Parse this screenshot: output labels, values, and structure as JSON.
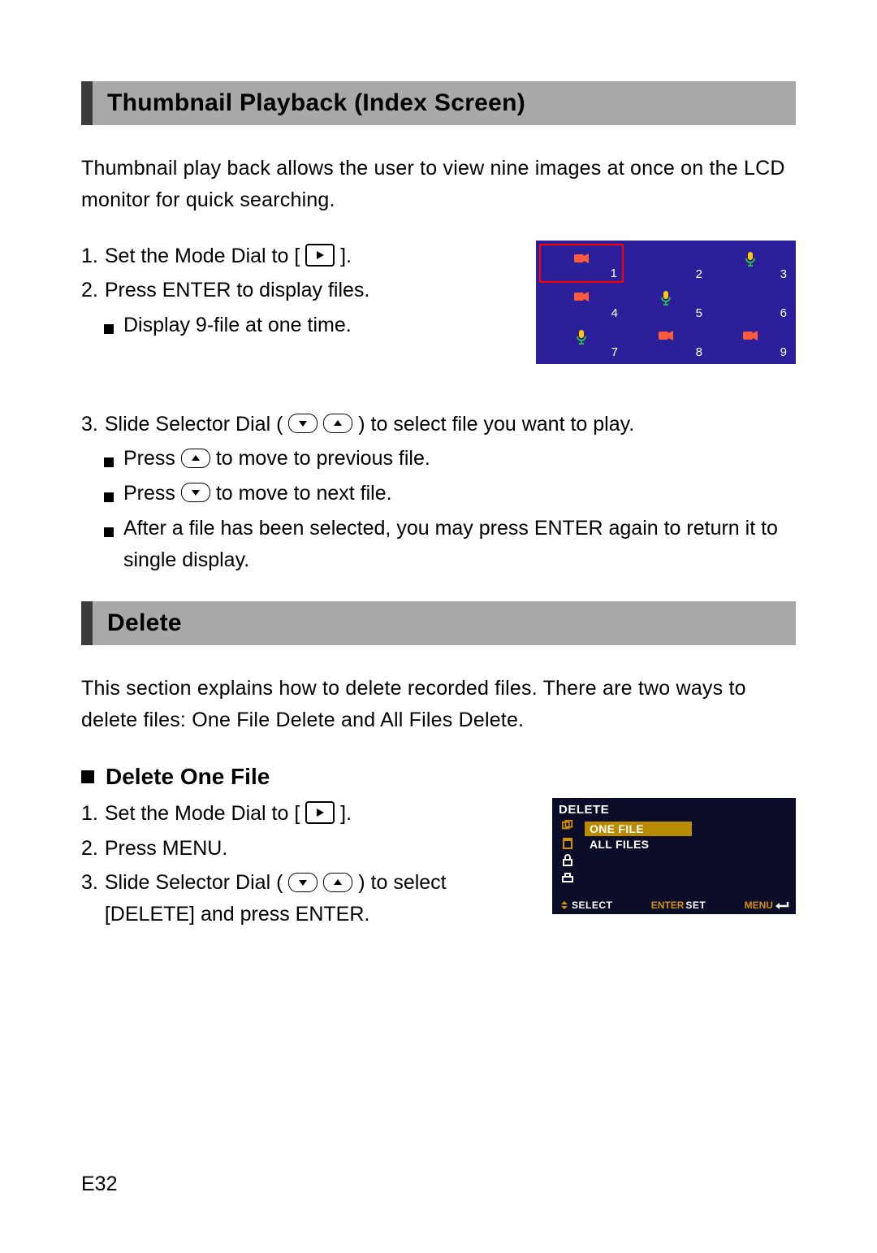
{
  "section1": {
    "title": "Thumbnail Playback (Index Screen)",
    "intro": "Thumbnail play back allows the user to view nine images at once on the LCD monitor for quick searching.",
    "step1_pre": "Set the Mode Dial to [",
    "step1_post": "].",
    "step2": "Press ENTER to display files.",
    "step2_sub": "Display 9-file at one time.",
    "step3_pre": "Slide Selector Dial (",
    "step3_post": ") to select file you want to play.",
    "step3_sub1_pre": "Press",
    "step3_sub1_post": "to move to previous file.",
    "step3_sub2_pre": "Press",
    "step3_sub2_post": "to move to next file.",
    "step3_sub3": "After a file has been selected, you may press ENTER again to return it to single display."
  },
  "thumbnails": {
    "cells": [
      {
        "n": "1",
        "icon": "video",
        "selected": true
      },
      {
        "n": "2",
        "icon": "",
        "selected": false
      },
      {
        "n": "3",
        "icon": "mic",
        "selected": false
      },
      {
        "n": "4",
        "icon": "video",
        "selected": false
      },
      {
        "n": "5",
        "icon": "mic",
        "selected": false
      },
      {
        "n": "6",
        "icon": "",
        "selected": false
      },
      {
        "n": "7",
        "icon": "mic",
        "selected": false
      },
      {
        "n": "8",
        "icon": "video",
        "selected": false
      },
      {
        "n": "9",
        "icon": "video",
        "selected": false
      }
    ]
  },
  "section2": {
    "title": "Delete",
    "intro": "This section explains how to delete recorded files. There are two ways to delete files: One File Delete and All Files Delete.",
    "subheading": "Delete One File",
    "step1_pre": "Set the Mode Dial to [",
    "step1_post": "].",
    "step2": "Press MENU.",
    "step3_pre": "Slide Selector Dial (",
    "step3_post": ") to select [DELETE] and press ENTER."
  },
  "delete_menu": {
    "title": "DELETE",
    "opt1": "ONE FILE",
    "opt2": "ALL FILES",
    "footer_select": "SELECT",
    "footer_enter": "ENTER",
    "footer_set": "SET",
    "footer_menu": "MENU"
  },
  "page_number": "E32"
}
